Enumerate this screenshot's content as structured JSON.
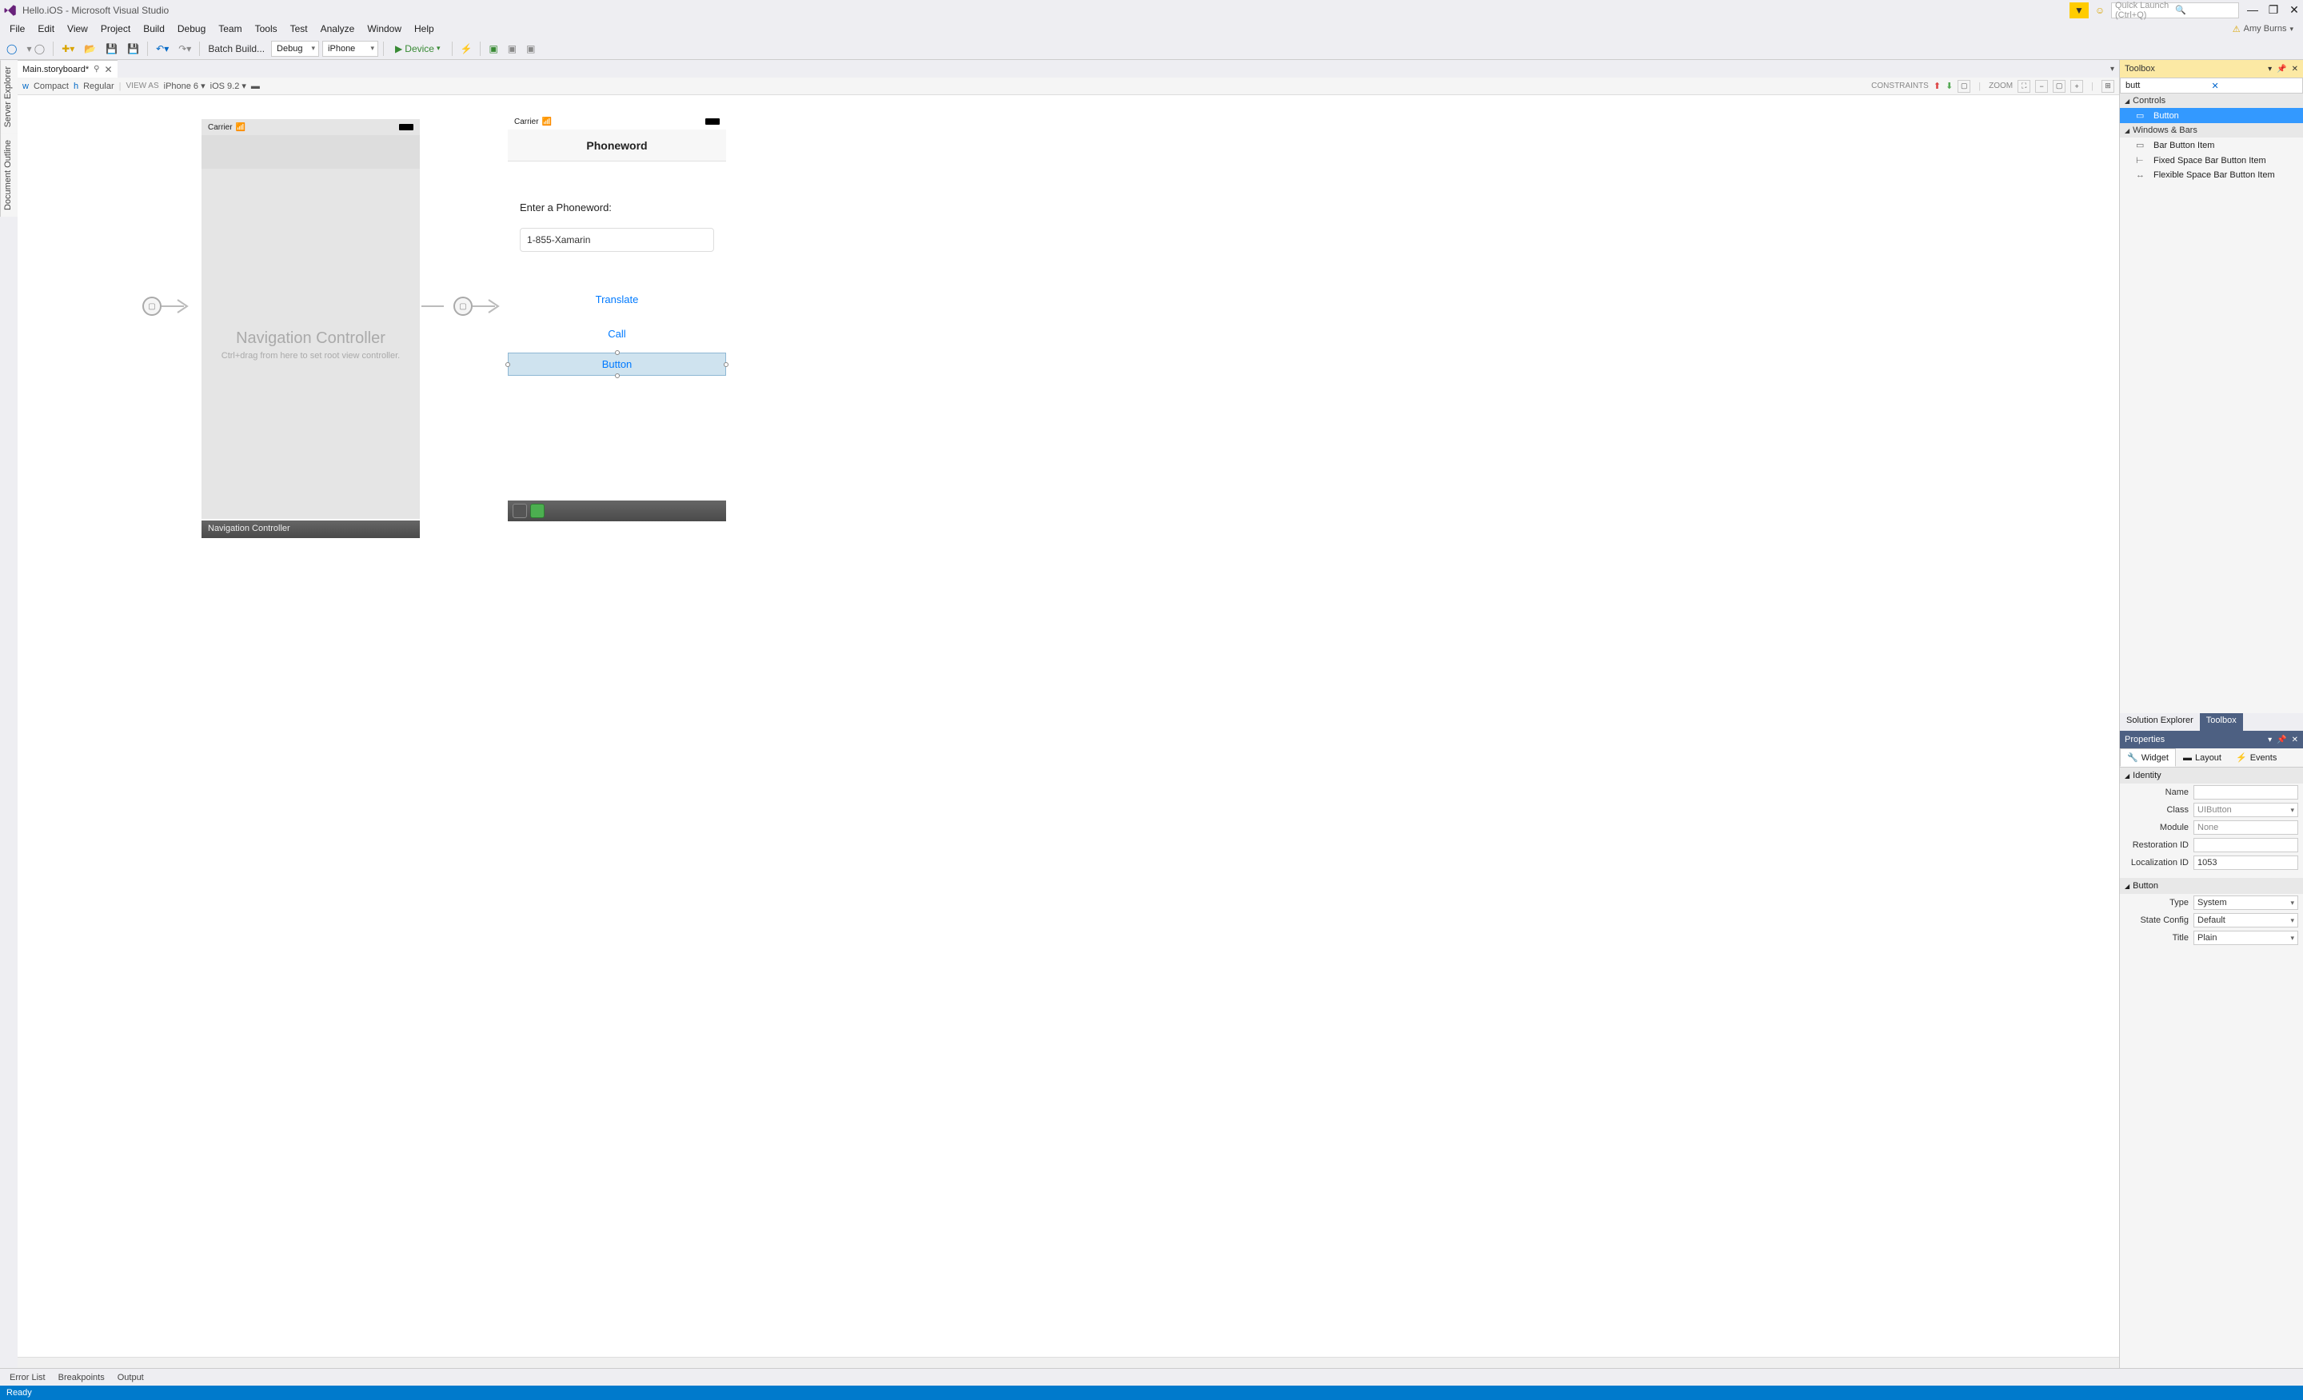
{
  "title": "Hello.iOS - Microsoft Visual Studio",
  "search_placeholder": "Quick Launch (Ctrl+Q)",
  "user": "Amy Burns",
  "menu": [
    "File",
    "Edit",
    "View",
    "Project",
    "Build",
    "Debug",
    "Team",
    "Tools",
    "Test",
    "Analyze",
    "Window",
    "Help"
  ],
  "toolbar": {
    "batch": "Batch Build...",
    "config": "Debug",
    "platform": "iPhone",
    "device": "Device"
  },
  "doc_tab": "Main.storyboard*",
  "designer": {
    "size_w": "wCompact",
    "size_h": "hRegular",
    "view_as": "VIEW AS",
    "device": "iPhone 6",
    "ios": "iOS 9.2",
    "constraints": "CONSTRAINTS",
    "zoom": "ZOOM"
  },
  "nav_controller": {
    "carrier": "Carrier",
    "title": "Navigation Controller",
    "hint": "Ctrl+drag from here to set root view controller.",
    "footer": "Navigation Controller"
  },
  "view_controller": {
    "carrier": "Carrier",
    "navbar_title": "Phoneword",
    "label": "Enter a Phoneword:",
    "textfield": "1-855-Xamarin",
    "translate": "Translate",
    "call": "Call",
    "button": "Button"
  },
  "left_tabs": [
    "Server Explorer",
    "Document Outline"
  ],
  "toolbox": {
    "title": "Toolbox",
    "search": "butt",
    "groups": [
      {
        "name": "Controls",
        "items": [
          {
            "icon": "▭",
            "label": "Button",
            "selected": true
          }
        ]
      },
      {
        "name": "Windows & Bars",
        "items": [
          {
            "icon": "▭",
            "label": "Bar Button Item"
          },
          {
            "icon": "⊢",
            "label": "Fixed Space Bar Button Item"
          },
          {
            "icon": "↔",
            "label": "Flexible Space Bar Button Item"
          }
        ]
      }
    ]
  },
  "bottom_tabs": [
    "Solution Explorer",
    "Toolbox"
  ],
  "properties": {
    "title": "Properties",
    "tabs": [
      "Widget",
      "Layout",
      "Events"
    ],
    "identity": {
      "section": "Identity",
      "name": "",
      "class": "UIButton",
      "module": "None",
      "restoration": "",
      "localization": "1053"
    },
    "button": {
      "section": "Button",
      "type": "System",
      "state": "Default",
      "title": "Plain"
    },
    "labels": {
      "name": "Name",
      "class": "Class",
      "module": "Module",
      "restoration": "Restoration ID",
      "localization": "Localization ID",
      "type": "Type",
      "state": "State Config",
      "title": "Title"
    }
  },
  "tray": [
    "Error List",
    "Breakpoints",
    "Output"
  ],
  "status": "Ready"
}
